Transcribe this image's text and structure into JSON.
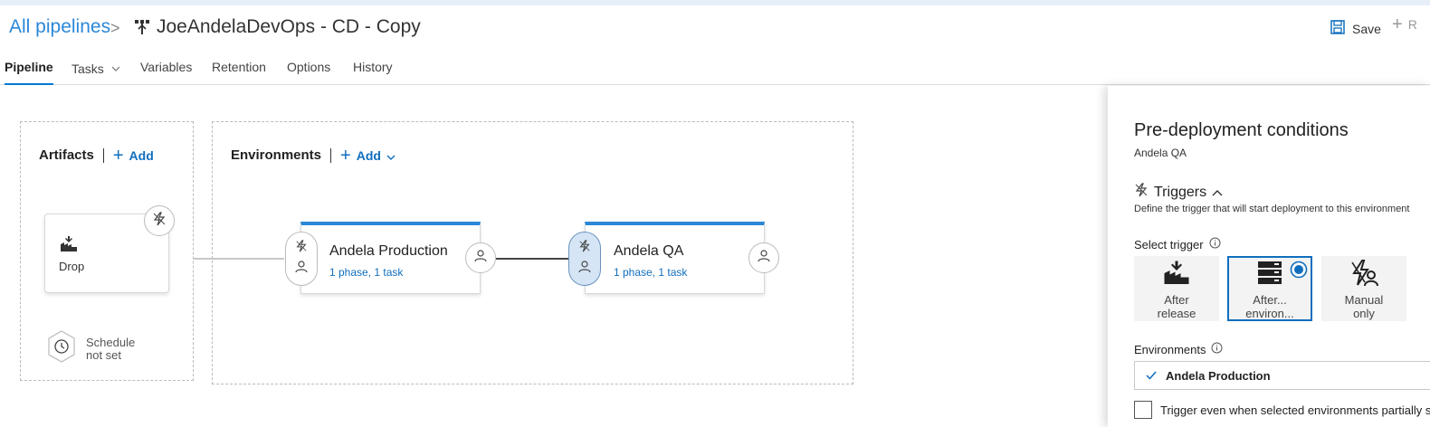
{
  "breadcrumb": {
    "all_pipelines": "All pipelines",
    "separator": ">",
    "pipeline_name": "JoeAndelaDevOps - CD - Copy"
  },
  "toolbar": {
    "save_label": "Save",
    "next_action_partial": "R"
  },
  "tabs": [
    {
      "label": "Pipeline",
      "active": true
    },
    {
      "label": "Tasks",
      "has_dropdown": true
    },
    {
      "label": "Variables"
    },
    {
      "label": "Retention"
    },
    {
      "label": "Options"
    },
    {
      "label": "History"
    }
  ],
  "artifacts": {
    "title": "Artifacts",
    "add_label": "Add",
    "items": [
      {
        "name": "Drop",
        "icon": "build-factory-icon"
      }
    ],
    "schedule": {
      "line1": "Schedule",
      "line2": "not set"
    }
  },
  "environments": {
    "title": "Environments",
    "add_label": "Add",
    "items": [
      {
        "name": "Andela Production",
        "summary": "1 phase, 1 task",
        "selected": false
      },
      {
        "name": "Andela QA",
        "summary": "1 phase, 1 task",
        "selected": true
      }
    ]
  },
  "side_panel": {
    "title": "Pre-deployment conditions",
    "subtitle": "Andela QA",
    "triggers_label": "Triggers",
    "triggers_desc": "Define the trigger that will start deployment to this environment",
    "select_trigger_label": "Select trigger",
    "trigger_options": [
      {
        "line1": "After",
        "line2": "release",
        "icon": "build-factory-icon",
        "selected": false
      },
      {
        "line1": "After...",
        "line2": "environ...",
        "icon": "server-stack-icon",
        "selected": true
      },
      {
        "line1": "Manual",
        "line2": "only",
        "icon": "manual-trigger-icon",
        "selected": false
      }
    ],
    "environments_label": "Environments",
    "selected_environment": "Andela Production",
    "checkbox_label": "Trigger even when selected environments partially succeed"
  },
  "colors": {
    "accent": "#0078d4",
    "link": "#106ebe",
    "env_top_border": "#2b88d8",
    "selected_pill": "#d5e5f5"
  }
}
